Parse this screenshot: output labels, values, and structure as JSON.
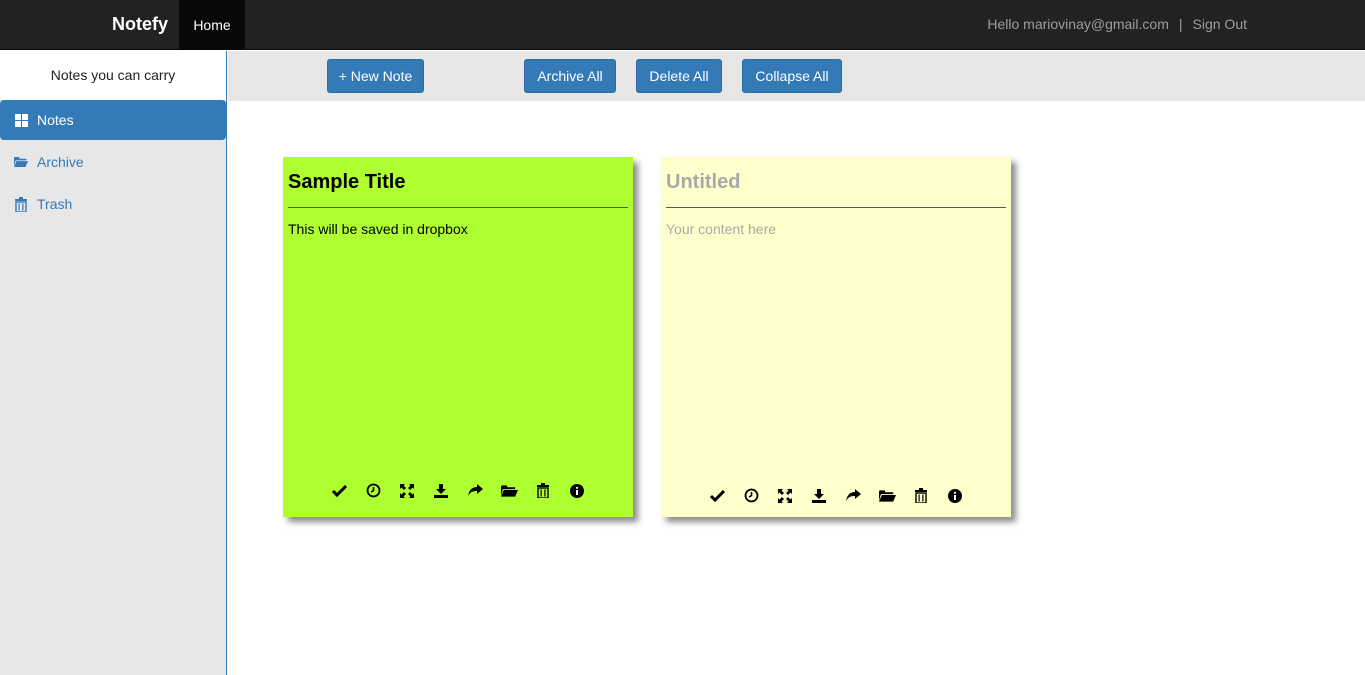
{
  "navbar": {
    "brand": "Notefy",
    "home_label": "Home",
    "greeting": "Hello mariovinay@gmail.com",
    "separator": "|",
    "signout_label": "Sign Out"
  },
  "sidebar": {
    "tagline": "Notes you can carry",
    "items": [
      {
        "label": "Notes",
        "icon": "grid-icon",
        "active": true
      },
      {
        "label": "Archive",
        "icon": "folder-open-icon",
        "active": false
      },
      {
        "label": "Trash",
        "icon": "trash-icon",
        "active": false
      }
    ]
  },
  "toolbar": {
    "new_note_label": "+ New Note",
    "archive_all_label": "Archive All",
    "delete_all_label": "Delete All",
    "collapse_all_label": "Collapse All"
  },
  "notes": [
    {
      "title": "Sample Title",
      "content": "This will be saved in dropbox",
      "color": "#adff2f"
    },
    {
      "title": "Untitled",
      "content": "Your content here",
      "color": "#ffffcc",
      "is_placeholder": true
    }
  ],
  "note_actions": [
    "check-icon",
    "clock-icon",
    "fullscreen-icon",
    "download-icon",
    "share-icon",
    "folder-open-icon",
    "trash-icon",
    "info-icon"
  ],
  "colors": {
    "navbar_bg": "#222222",
    "accent": "#337ab7",
    "sidebar_bg": "#e7e7e7"
  }
}
